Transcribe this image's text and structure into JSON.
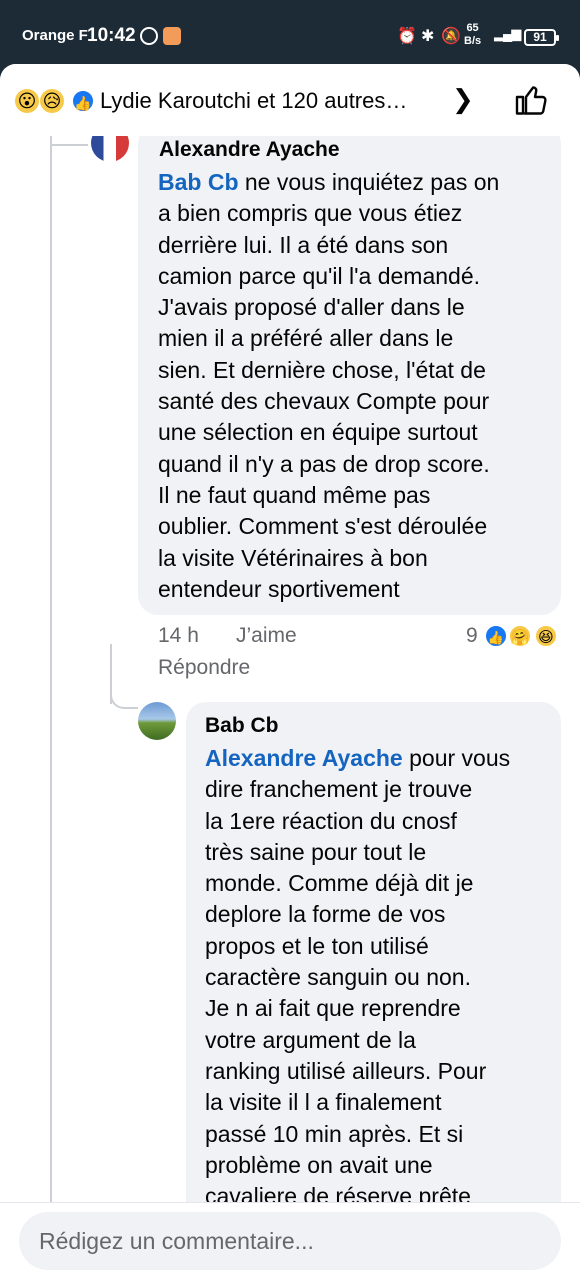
{
  "status_bar": {
    "carrier": "Orange F",
    "time": "10:42",
    "speed_value": "65",
    "speed_unit": "B/s",
    "battery": "91"
  },
  "header": {
    "title": "Lydie Karoutchi et 120 autres…",
    "reactions": [
      "wow-emoji",
      "sad-emoji",
      "like-emoji"
    ]
  },
  "comments": [
    {
      "author": "Alexandre Ayache",
      "mention": "Bab Cb",
      "lines": [
        " ne vous inquiétez pas on",
        "a bien compris que vous étiez",
        "derrière lui. Il a été dans son",
        "camion parce qu'il l'a demandé.",
        "J'avais proposé d'aller dans le",
        "mien il a préféré aller dans le",
        "sien. Et dernière chose, l'état de",
        "santé des chevaux Compte pour",
        "une sélection en équipe surtout",
        "quand il n'y a pas de drop score.",
        "Il ne faut quand même pas",
        "oublier. Comment s'est déroulée",
        "la visite Vétérinaires à bon",
        "entendeur sportivement"
      ],
      "time": "14 h",
      "like_label": "J’aime",
      "reply_label": "Répondre",
      "reaction_count": "9"
    },
    {
      "author": "Bab Cb",
      "mention": "Alexandre Ayache",
      "lines": [
        " pour vous",
        "dire franchement je trouve",
        "la 1ere réaction du cnosf",
        "très saine pour tout le",
        "monde. Comme déjà dit je",
        "deplore la forme de vos",
        "propos et le ton utilisé",
        "caractère sanguin ou non.",
        "Je n ai fait que reprendre",
        "votre argument de la",
        "ranking utilisé ailleurs. Pour",
        "la visite il l a finalement",
        "passé 10 min après. Et si",
        "problème on avait une",
        "cavaliere de réserve prête"
      ]
    }
  ],
  "composer": {
    "placeholder": "Rédigez un commentaire..."
  },
  "colors": {
    "mention": "#1565c0",
    "bubble": "#f0f2f5",
    "status_bar": "#1c2b36",
    "like_blue": "#1877f2"
  }
}
